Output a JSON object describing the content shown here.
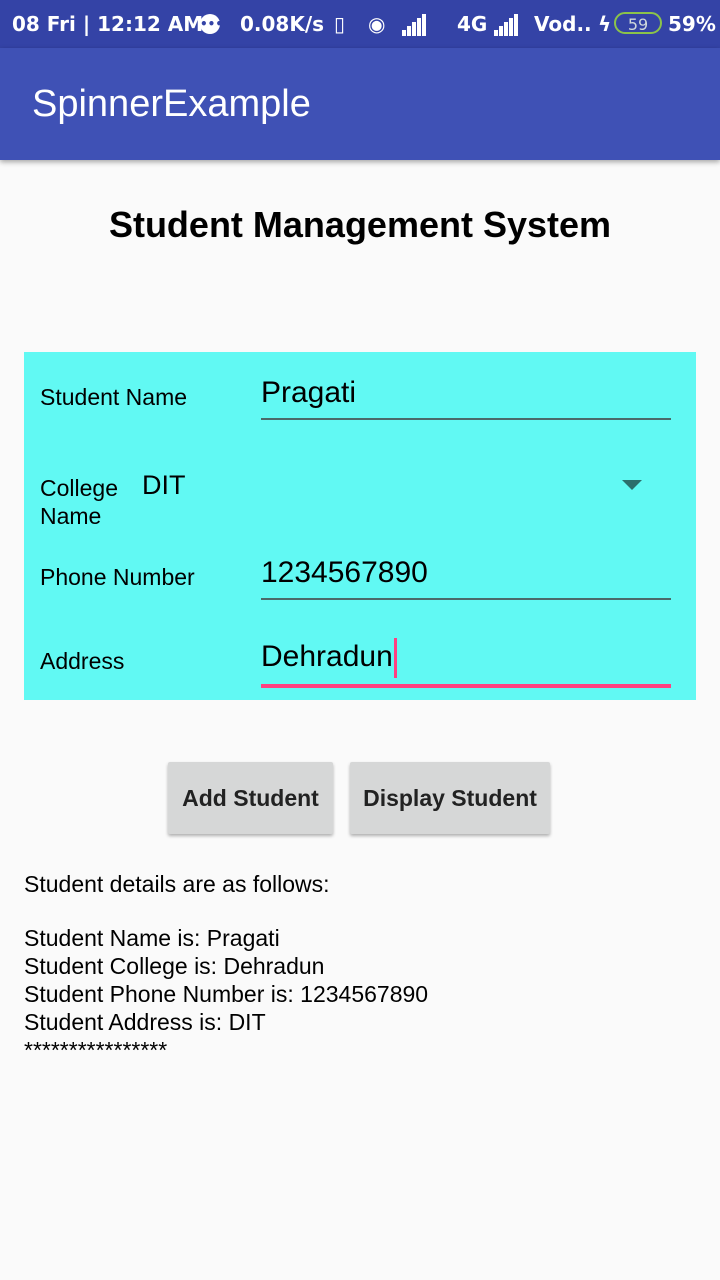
{
  "status_bar": {
    "left_text": "08 Fri | 12:12 AM",
    "speed": "0.08K/s",
    "network_type": "4G",
    "carrier": "Vod..",
    "battery_badge": "59",
    "battery_percent": "59%"
  },
  "app_bar": {
    "title": "SpinnerExample"
  },
  "page": {
    "title": "Student Management System"
  },
  "form": {
    "name_label": "Student Name",
    "name_value": "Pragati",
    "college_label": "College Name",
    "college_value": "DIT",
    "phone_label": "Phone Number",
    "phone_value": "1234567890",
    "address_label": "Address",
    "address_value": "Dehradun",
    "background_color": "#61f9f3",
    "focus_color": "#ff4081"
  },
  "buttons": {
    "add_label": "Add Student",
    "display_label": "Display Student"
  },
  "output": {
    "header": "Student details are as follows:",
    "lines": [
      "Student Name is: Pragati",
      "Student College is: Dehradun",
      "Student Phone Number is: 1234567890",
      "Student Address is: DIT",
      "****************"
    ]
  },
  "colors": {
    "primary": "#3f51b5",
    "primary_dark": "#3443a6",
    "accent": "#ff4081"
  },
  "icons": [
    "notification-dot-icon",
    "vibrate-icon",
    "hotspot-icon",
    "signal-icon",
    "charging-icon",
    "battery-icon",
    "dropdown-arrow-icon"
  ]
}
